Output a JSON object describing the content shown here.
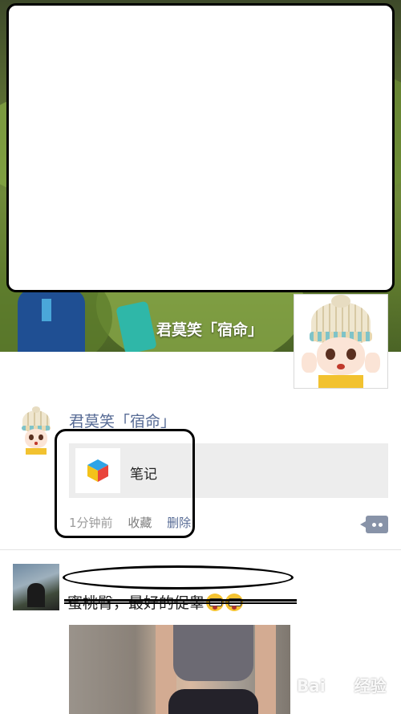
{
  "cover": {
    "name": "君莫笑「宿命」"
  },
  "post1": {
    "author": "君莫笑「宿命」",
    "note_title": "笔记",
    "time": "1分钟前",
    "favorite": "收藏",
    "delete": "删除",
    "note_icon": "colorful-cube-icon",
    "comment_icon": "comment-more-icon"
  },
  "post2": {
    "text": "蜜桃臀，最好的促睾"
  },
  "watermark": {
    "text_left": "Bai",
    "text_right": "经验"
  },
  "colors": {
    "link_blue": "#576b95",
    "card_gray": "#ededed",
    "meta_gray": "#9b9b9b"
  }
}
